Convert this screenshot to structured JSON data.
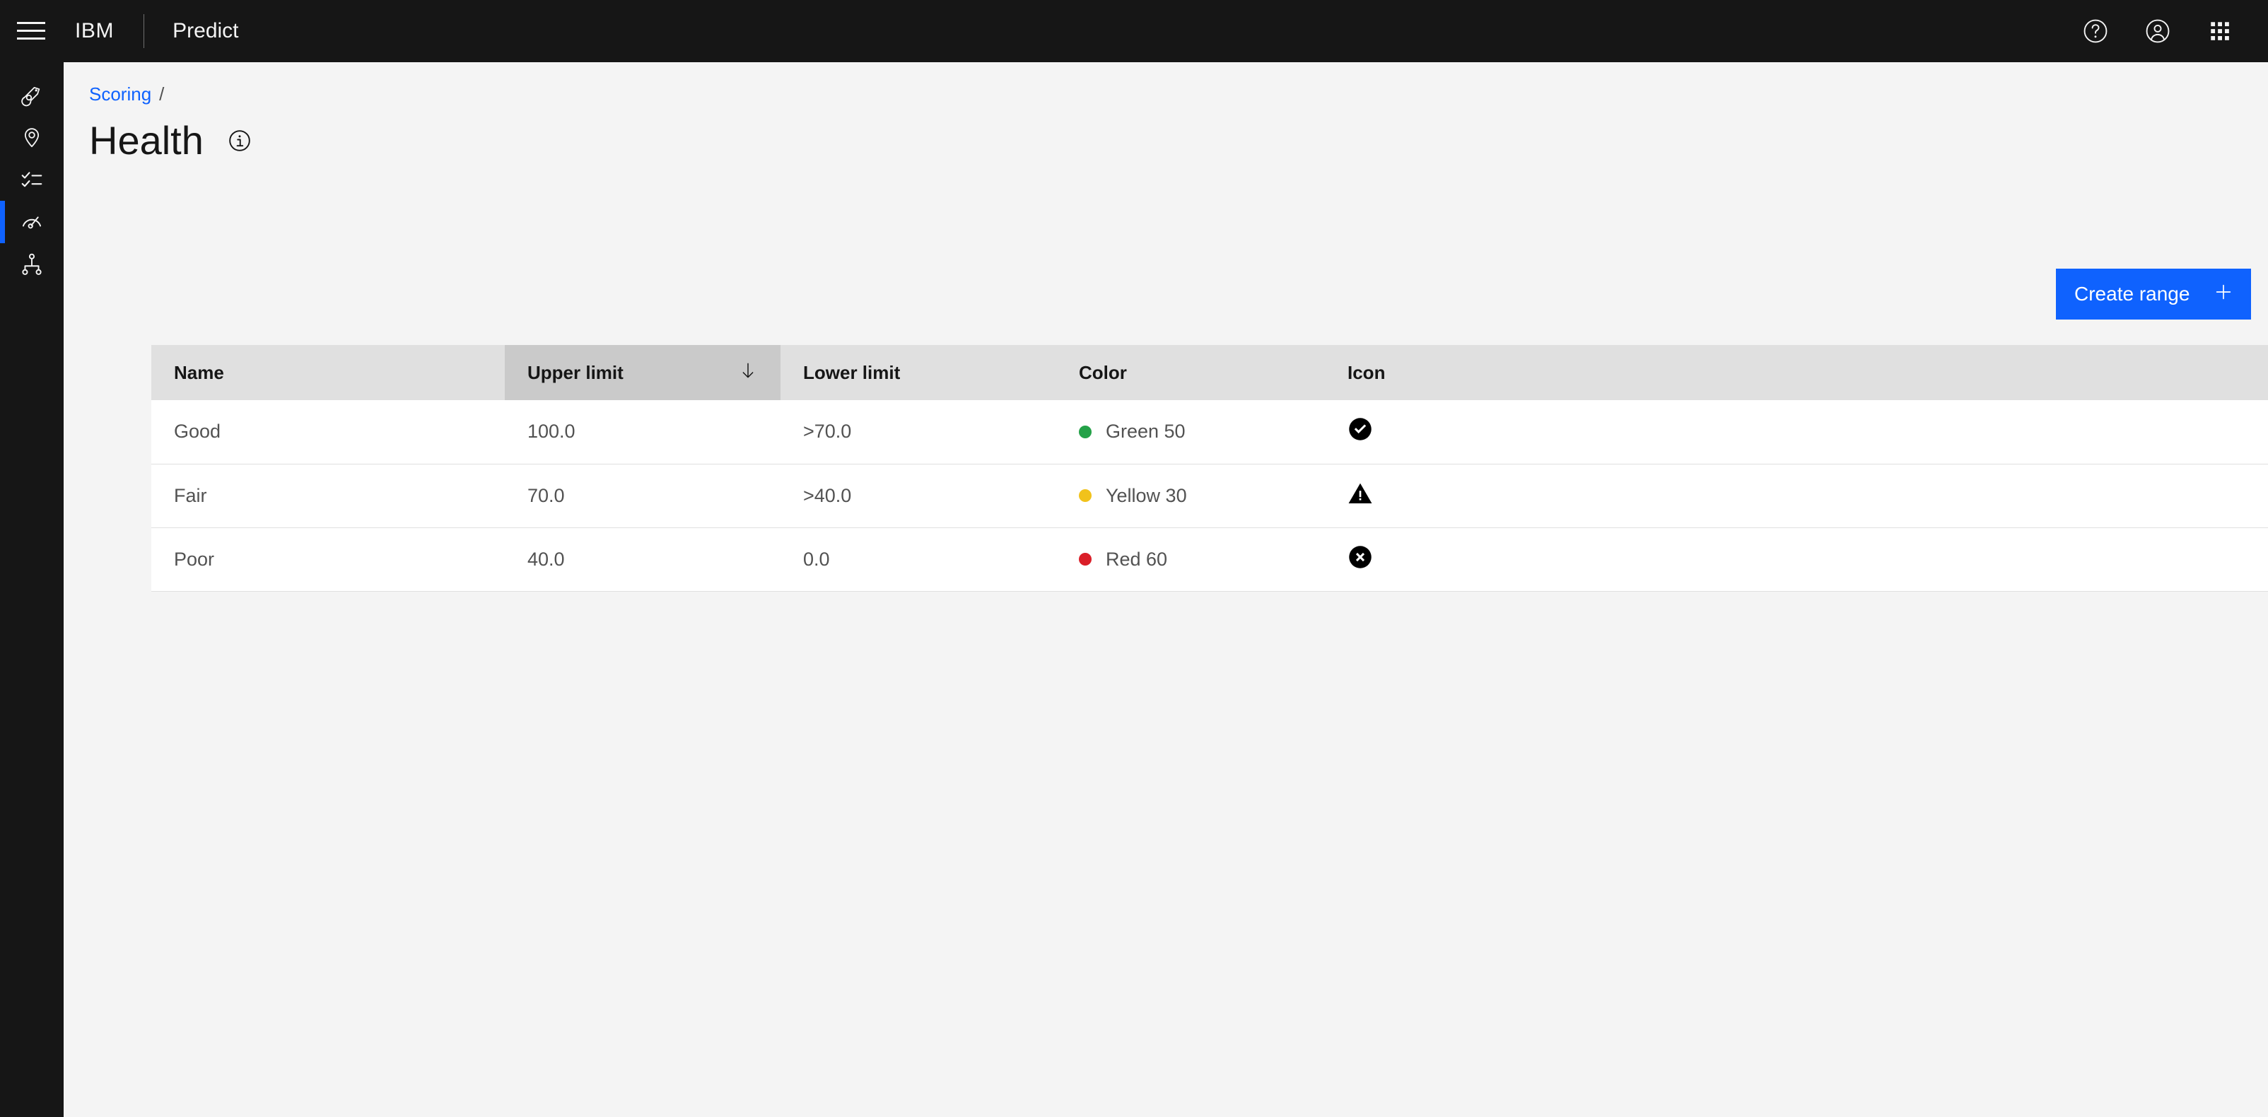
{
  "header": {
    "menu_icon": "hamburger-menu-icon",
    "brand": "IBM",
    "product": "Predict",
    "actions": [
      {
        "name": "help-icon",
        "label": "Help"
      },
      {
        "name": "user-avatar-icon",
        "label": "Account"
      },
      {
        "name": "app-switcher-icon",
        "label": "App switcher"
      }
    ]
  },
  "sidebar": {
    "items": [
      {
        "name": "sidebar-item-assets",
        "icon": "asset-icon",
        "active": false
      },
      {
        "name": "sidebar-item-locations",
        "icon": "location-pin-icon",
        "active": false
      },
      {
        "name": "sidebar-item-tasks",
        "icon": "checklist-icon",
        "active": false
      },
      {
        "name": "sidebar-item-scoring",
        "icon": "gauge-icon",
        "active": true
      },
      {
        "name": "sidebar-item-hierarchy",
        "icon": "hierarchy-icon",
        "active": false
      }
    ]
  },
  "breadcrumb": {
    "link": "Scoring",
    "separator": "/"
  },
  "page": {
    "title": "Health",
    "info_icon": "information-icon"
  },
  "toolbar": {
    "create_range_label": "Create range",
    "create_range_icon": "plus-icon",
    "accent_color": "#0f62fe"
  },
  "table": {
    "columns": [
      {
        "key": "name",
        "label": "Name",
        "sorted": false
      },
      {
        "key": "upper",
        "label": "Upper limit",
        "sorted": true,
        "sort_direction": "descending",
        "sort_icon": "arrow-down-icon"
      },
      {
        "key": "lower",
        "label": "Lower limit",
        "sorted": false
      },
      {
        "key": "color",
        "label": "Color",
        "sorted": false
      },
      {
        "key": "icon",
        "label": "Icon",
        "sorted": false
      }
    ],
    "rows": [
      {
        "name": "Good",
        "upper": "100.0",
        "lower": ">70.0",
        "color_label": "Green 50",
        "color_hex": "#24a148",
        "status_icon": "checkmark-filled-icon"
      },
      {
        "name": "Fair",
        "upper": "70.0",
        "lower": ">40.0",
        "color_label": "Yellow 30",
        "color_hex": "#f1c21b",
        "status_icon": "warning-filled-icon"
      },
      {
        "name": "Poor",
        "upper": "40.0",
        "lower": "0.0",
        "color_label": "Red 60",
        "color_hex": "#da1e28",
        "status_icon": "error-filled-icon"
      }
    ]
  }
}
